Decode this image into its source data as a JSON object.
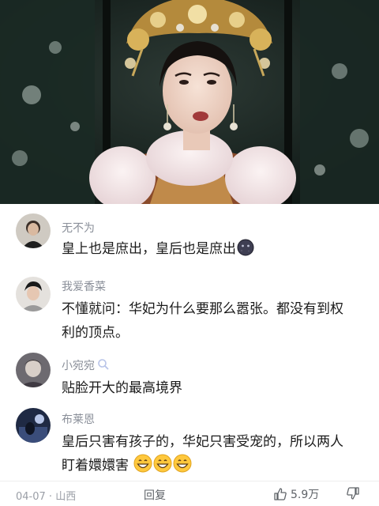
{
  "comments": [
    {
      "username": "无不为",
      "text_lines": [
        "皇上也是庶出，皇后也是庶出"
      ],
      "emoji": "dark-moon-face-icon"
    },
    {
      "username": "我爱香菜",
      "text_lines": [
        "不懂就问：华妃为什么要那么嚣张。都没有到权",
        "利的顶点。"
      ]
    },
    {
      "username": "小宛宛",
      "text_lines": [
        "贴脸开大的最高境界"
      ],
      "badge": "search-badge-icon"
    },
    {
      "username": "布莱恩",
      "text_lines": [
        "皇后只害有孩子的，华妃只害受宠的，所以两人",
        "盯着嬛嬛害"
      ],
      "emoji": "grinning-face-icon",
      "emoji_count": 3
    }
  ],
  "footer": {
    "date": "04-07",
    "separator": "·",
    "location": "山西",
    "reply_label": "回复",
    "like_count": "5.9万"
  },
  "colors": {
    "username": "#8a8f99",
    "text": "#1a1a1a",
    "meta": "#9a9ea6",
    "background": "#ffffff"
  }
}
